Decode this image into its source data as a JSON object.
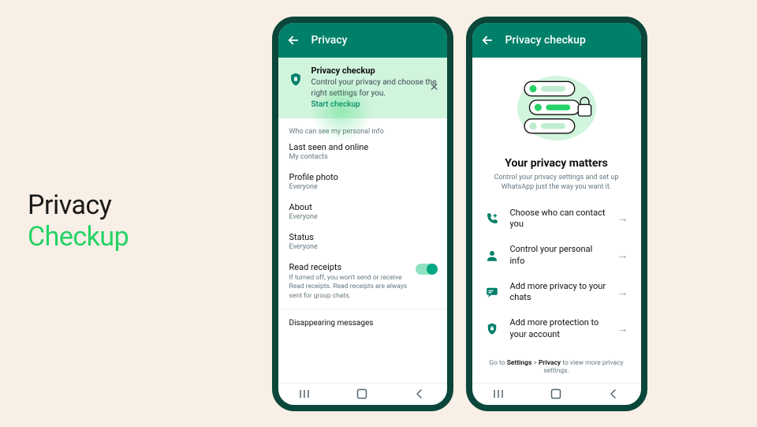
{
  "promo": {
    "line1": "Privacy",
    "line2": "Checkup"
  },
  "colors": {
    "brand": "#008069",
    "accent": "#25d366"
  },
  "phone1": {
    "title": "Privacy",
    "banner": {
      "title": "Privacy checkup",
      "body": "Control your privacy and choose the right settings for you.",
      "cta": "Start checkup",
      "icon": "lock-shield-icon"
    },
    "section_header": "Who can see my personal info",
    "items": [
      {
        "label": "Last seen and online",
        "value": "My contacts"
      },
      {
        "label": "Profile photo",
        "value": "Everyone"
      },
      {
        "label": "About",
        "value": "Everyone"
      },
      {
        "label": "Status",
        "value": "Everyone"
      }
    ],
    "read_receipts": {
      "label": "Read receipts",
      "desc": "If turned off, you won't send or receive Read receipts. Read receipts are always sent for group chats.",
      "on": true
    },
    "disappearing": "Disappearing messages"
  },
  "phone2": {
    "title": "Privacy checkup",
    "hero_title": "Your privacy matters",
    "hero_sub": "Control your privacy settings and set up WhatsApp just the way you want it.",
    "options": [
      {
        "icon": "phone-plus-icon",
        "label": "Choose who can contact you"
      },
      {
        "icon": "person-icon",
        "label": "Control your personal info"
      },
      {
        "icon": "chat-icon",
        "label": "Add more privacy to your chats"
      },
      {
        "icon": "lock-shield-icon",
        "label": "Add more protection to your account"
      }
    ],
    "footnote_pre": "Go to ",
    "footnote_b1": "Settings",
    "footnote_mid": " > ",
    "footnote_b2": "Privacy",
    "footnote_post": " to view more privacy settings."
  }
}
